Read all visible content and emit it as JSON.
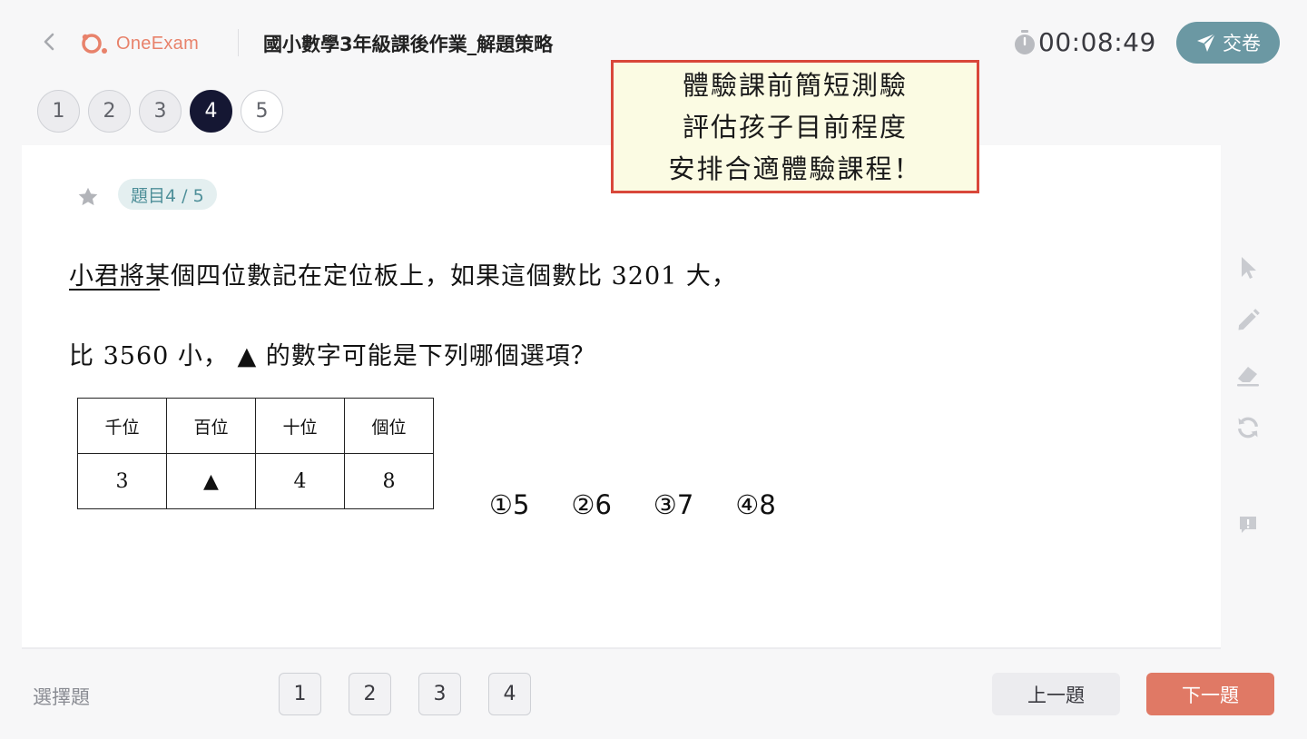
{
  "header": {
    "logo_text": "OneExam",
    "title": "國小數學3年級課後作業_解題策略",
    "timer": "00:08:49",
    "submit_label": "交卷",
    "icons": {
      "back": "chevron-left-icon",
      "timer": "stopwatch-icon",
      "submit": "paper-plane-icon"
    }
  },
  "question_nav": {
    "numbers": [
      "1",
      "2",
      "3",
      "4",
      "5"
    ],
    "active_index": 3
  },
  "annotation": {
    "lines": [
      "體驗課前簡短測驗",
      "評估孩子目前程度",
      "安排合適體驗課程！"
    ],
    "border_color": "#d9473a",
    "background_color": "#fbfbe3"
  },
  "question": {
    "badge": "題目4 / 5",
    "line1": "小君將某個四位數記在定位板上，如果這個數比 3201 大，",
    "line2": "比 3560 小， ▲ 的數字可能是下列哪個選項？",
    "table": {
      "headers": [
        "千位",
        "百位",
        "十位",
        "個位"
      ],
      "values": [
        "3",
        "▲",
        "4",
        "8"
      ]
    },
    "options": [
      "①5",
      "②6",
      "③7",
      "④8"
    ]
  },
  "tools": [
    "cursor-icon",
    "pencil-icon",
    "eraser-icon",
    "refresh-icon",
    "report-icon"
  ],
  "footer": {
    "question_type": "選擇題",
    "answer_buttons": [
      "1",
      "2",
      "3",
      "4"
    ],
    "prev_label": "上一題",
    "next_label": "下一題"
  },
  "colors": {
    "accent_teal": "#6b98a3",
    "active_dark": "#151733",
    "next_orange": "#e07965",
    "logo_orange": "#e8826b"
  }
}
